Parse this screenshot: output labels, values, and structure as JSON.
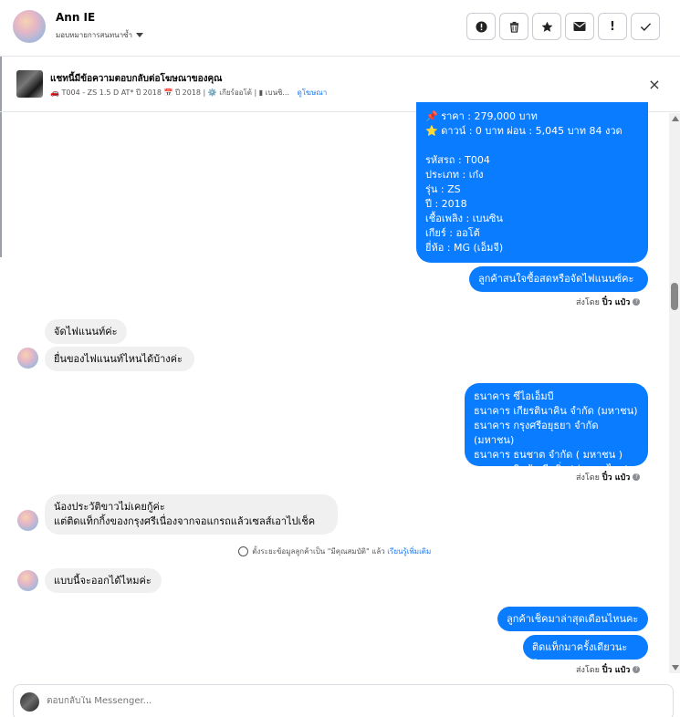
{
  "header": {
    "contact_name": "Ann IE",
    "assign_label": "มอบหมายการสนทนาซ้ำ",
    "actions": [
      "!",
      "🗑",
      "★",
      "✉",
      "!",
      "✓"
    ]
  },
  "ad": {
    "title": "แชทนี้มีข้อความตอบกลับต่อโฆษณาของคุณ",
    "subtitle": "🚗 T004 - ZS 1.5 D AT* ปี 2018 📅 ปี 2018 | ⚙️ เกียร์ออโต้ | ▮ เบนซิ...",
    "link": "ดูโฆษณา",
    "close": "×"
  },
  "messages": {
    "m1": "📌 ราคา : 279,000 บาท\n⭐ ดาวน์ : 0 บาท ผ่อน : 5,045 บาท 84 งวด\n\n   รหัสรถ : T004\n   ประเภท : เก๋ง\n   รุ่น : ZS\n   ปี : 2018\n   เชื้อเพลิง : เบนซิน\n   เกียร์ : ออโต้\n   ยี่ห้อ : MG (เอ็มจี)",
    "m2": "ลูกค้าสนใจซื้อสดหรือจัดไฟแนนซ์คะ",
    "sent1_prefix": "ส่งโดย",
    "sent1_name": "ปิ๋ว แป๋ว",
    "m3": "จัดไฟแนนท์ค่ะ",
    "m4": "ยื่นของไฟแนนท์ไหนได้บ้างค่ะ",
    "m5": "ธนาคาร ซีไอเอ็มบี\nธนาคาร เกียรตินาคิน จำกัด (มหาชน)\nธนาคาร กรุงศรีอยุธยา จำกัด (มหาชน)\nธนาคาร ธนชาต จำกัด ( มหาชน )\nธนาคาร  นิสสัน ลีสซิ่ง (ประเทศไทย)",
    "sent2_prefix": "ส่งโดย",
    "sent2_name": "ปิ๋ว แป๋ว",
    "m6": "น้องประวัติขาวไม่เคยกู้ค่ะ\nแต่ติดแท็กกิ้งของกรุงศรีเนื่องจากจอแกรถแล้วเซลส์เอาไปเช็ค",
    "system_text": "ตั้งระยะข้อมูลลูกค้าเป็น \"มีคุณสมบัติ\" แล้ว",
    "system_link": "เรียนรู้เพิ่มเติม",
    "m7": "แบบนี้จะออกได้ไหมค่ะ",
    "m8": "ลูกค้าเช็คมาล่าสุดเดือนไหนคะ",
    "m9": "ติดแท็กมาครั้งเดียวนะคะ",
    "sent3_prefix": "ส่งโดย",
    "sent3_name": "ปิ๋ว แป๋ว"
  },
  "composer": {
    "placeholder": "ตอบกลับใน Messenger..."
  },
  "colors": {
    "accent": "#0a7cff",
    "incoming": "#f0f0f0"
  }
}
